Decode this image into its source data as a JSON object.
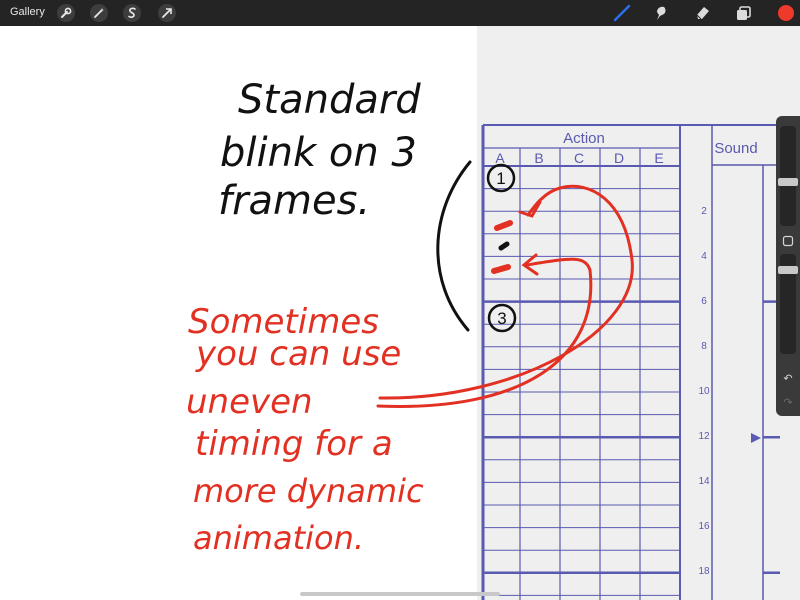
{
  "toolbar": {
    "gallery_label": "Gallery",
    "left_tools": [
      {
        "icon": "wrench-icon",
        "glyph": "🔧"
      },
      {
        "icon": "magic-wand-icon",
        "glyph": "✦"
      },
      {
        "icon": "selection-icon",
        "glyph": "S"
      },
      {
        "icon": "transform-arrow-icon",
        "glyph": "➚"
      }
    ],
    "right_tools": [
      "brush-icon",
      "smudge-icon",
      "eraser-icon",
      "layers-icon",
      "color-swatch-icon"
    ],
    "active_tool": "brush",
    "brush_color": "#2a6ff0",
    "current_color": "#ee3a2a"
  },
  "sheet": {
    "action_header": "Action",
    "action_columns": [
      "A",
      "B",
      "C",
      "D",
      "E"
    ],
    "sound_header": "Sound",
    "frame_numbers": [
      "2",
      "4",
      "6",
      "8",
      "10",
      "12",
      "14",
      "16",
      "18"
    ],
    "line_color": "#5a5ab0"
  },
  "annotations": {
    "black_note": [
      "Standard",
      "blink on 3",
      "frames."
    ],
    "red_note": [
      "Sometimes",
      "you can use",
      "uneven",
      "timing for a",
      "more dynamic",
      "animation."
    ],
    "frame_markers": [
      "1",
      "3"
    ],
    "black_color": "#111111",
    "red_color": "#e23022"
  },
  "sidebar": {
    "undo_glyph": "↶",
    "redo_glyph": "↷"
  }
}
